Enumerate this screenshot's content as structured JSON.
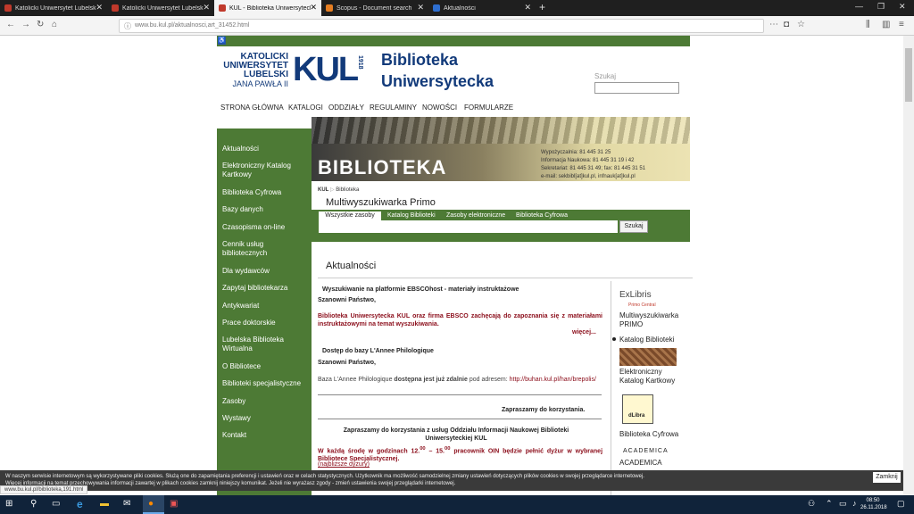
{
  "tabs": [
    {
      "title": "Katolicki Uniwersytet Lubelski",
      "color": "#c0392b"
    },
    {
      "title": "Katolicki Uniwersytet Lubelski",
      "color": "#c0392b"
    },
    {
      "title": "KUL - Biblioteka Uniwersytecka",
      "color": "#c0392b"
    },
    {
      "title": "Scopus - Document search",
      "color": "#e67e22"
    },
    {
      "title": "Aktualności",
      "color": "#2e6fd1"
    }
  ],
  "url": "www.bu.kul.pl/aktualnosci,art_31452.html",
  "logo": {
    "line1": "KATOLICKI",
    "line2": "UNIWERSYTET",
    "line3": "LUBELSKI",
    "line4": "JANA PAWŁA II",
    "mark": "KUL",
    "year": "1918",
    "title1": "Biblioteka",
    "title2": "Uniwersytecka"
  },
  "search": {
    "label": "Szukaj"
  },
  "topnav": [
    "STRONA GŁÓWNA",
    "KATALOGI",
    "ODDZIAŁY",
    "REGULAMINY",
    "NOWOŚCI",
    "FORMULARZE"
  ],
  "sidebar": [
    "Aktualności",
    "Elektroniczny Katalog Kartkowy",
    "Biblioteka Cyfrowa",
    "Bazy danych",
    "Czasopisma on-line",
    "Cennik usług bibliotecznych",
    "Dla wydawców",
    "Zapytaj bibliotekarza",
    "Antykwariat",
    "Prace doktorskie",
    "Lubelska Biblioteka Wirtualna",
    "O Bibliotece",
    "Biblioteki specjalistyczne",
    "Zasoby",
    "Wystawy",
    "Kontakt"
  ],
  "banner": {
    "word": "BIBLIOTEKA",
    "info": [
      "Wypożyczalnia: 81 445 31 25",
      "Informacja Naukowa: 81 445 31 19 i 42",
      "Sekretariat: 81 445 31 49; fax: 81 445 31 51",
      "e-mail: sekbibl[at]kul.pl, infnauk[at]kul.pl"
    ]
  },
  "breadcrumb": {
    "home": "KUL",
    "current": "Biblioteka"
  },
  "primo": {
    "title": "Multiwyszukiwarka Primo",
    "tabs": [
      "Wszystkie zasoby",
      "Katalog Biblioteki",
      "Zasoby elektroniczne",
      "Biblioteka Cyfrowa"
    ],
    "button": "Szukaj"
  },
  "main": {
    "heading": "Aktualności",
    "n1": {
      "title": "Wyszukiwanie na platformie EBSCOhost - materiały instruktażowe",
      "greet": "Szanowni Państwo,",
      "body": "Biblioteka Uniwersytecka KUL oraz firma EBSCO zachęcają do zapoznania się z materiałami instruktażowymi na temat wyszukiwania.",
      "more": "więcej..."
    },
    "n2": {
      "title": "Dostęp do bazy L'Annee Philologique",
      "greet": "Szanowni Państwo,",
      "b1": "Baza L'Annee Philologique",
      "b2": "dostępna jest już zdalnie",
      "b3": "pod adresem:",
      "link": "http://buhan.kul.pl/han/brepolis/",
      "end": "Zapraszamy do korzystania."
    },
    "n3": {
      "title": "Zapraszamy do korzystania z usług Oddziału Informacji Naukowej Biblioteki Uniwersyteckiej KUL",
      "b1": "W każdą środę w godzinach 12.",
      "s1": "00",
      "b2": " – 15.",
      "s2": "00",
      "b3": " pracownik OIN będzie pełnić dyżur w wybranej Bibliotece Specjalistycznej.",
      "link": "(najbliższe dyżury)"
    }
  },
  "right": {
    "exlibris": "ExLibris",
    "primo_central": "Primo Central",
    "primo_text": "Multiwyszukiwarka PRIMO",
    "katalog": "Katalog Biblioteki",
    "kartkowy": "Elektroniczny Katalog Kartkowy",
    "dlibra": "dLibra",
    "cyfrowa": "Biblioteka Cyfrowa",
    "academica1": "ACADEMICA",
    "academica2": "ACADEMICA"
  },
  "cookie": {
    "line1": "W naszym serwisie internetowym są wykorzystywane pliki cookies. Służą one do zapamiętania preferencji i ustawień oraz w celach statystycznych. Użytkownik ma możliwość samodzielnej zmiany ustawień dotyczących plików cookies w swojej przeglądarce internetowej.",
    "line2": "Więcej informacji na temat przechowywania informacji zawartej w plikach cookies zamknij niniejszy komunikat. Jeżeli nie wyrażasz zgody - zmień ustawienia swojej przeglądarki internetowej.",
    "close": "Zamknij"
  },
  "status_url": "www.bu.kul.pl/biblioteka,191.html",
  "clock": {
    "time": "08:50",
    "date": "26.11.2018"
  }
}
